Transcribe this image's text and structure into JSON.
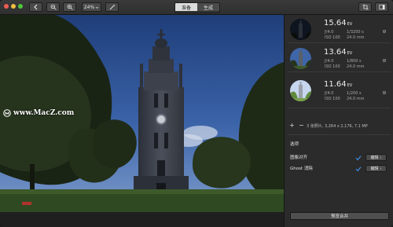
{
  "toolbar": {
    "zoom_value": "24%",
    "tab_prepare": "准备",
    "tab_generate": "生成"
  },
  "watermark": "www.MacZ.com",
  "shots": [
    {
      "ev": "15.64",
      "ev_unit": "EV",
      "aperture": "ƒ/4.0",
      "shutter": "1/3200 s",
      "iso": "ISO 100",
      "focal": "24.0 mm"
    },
    {
      "ev": "13.64",
      "ev_unit": "EV",
      "aperture": "ƒ/4.0",
      "shutter": "1/800 s",
      "iso": "ISO 100",
      "focal": "24.0 mm"
    },
    {
      "ev": "11.64",
      "ev_unit": "EV",
      "aperture": "ƒ/4.0",
      "shutter": "1/200 s",
      "iso": "ISO 100",
      "focal": "24.0 mm"
    }
  ],
  "add_remove": {
    "plus": "+",
    "minus": "−",
    "summary": "3 张照片, 3,264 x 2,176, 7.1 MP"
  },
  "options": {
    "title": "选项",
    "items": [
      {
        "label": "图像对齐",
        "edit": "编辑"
      },
      {
        "label": "Ghost 消除",
        "edit": "编辑"
      }
    ]
  },
  "preview_merge": "预览合并",
  "colors": {
    "accent": "#3b8ee8",
    "sidebar": "#2b2b2b",
    "toolbar": "#333333"
  }
}
